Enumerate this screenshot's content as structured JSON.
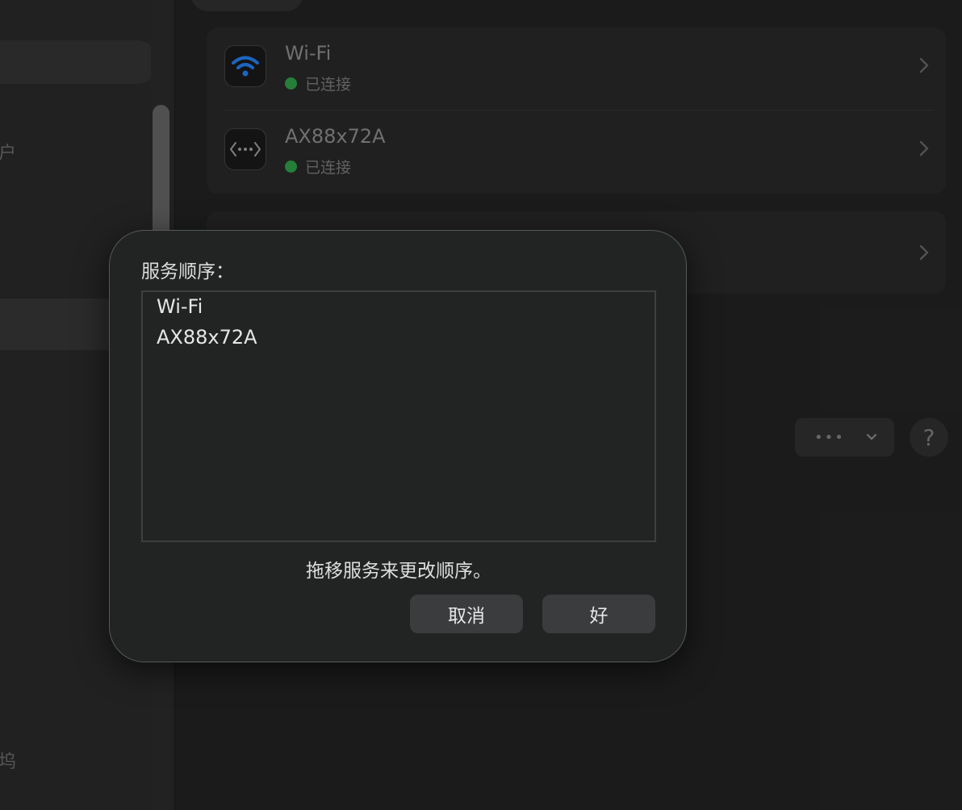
{
  "sidebar": {
    "partial_text_1": "户",
    "partial_text_2": "坞"
  },
  "services": [
    {
      "name": "Wi-Fi",
      "status": "已连接",
      "icon": "wifi-icon"
    },
    {
      "name": "AX88x72A",
      "status": "已连接",
      "icon": "ethernet-icon"
    }
  ],
  "toolbar": {
    "action_label": "•••",
    "help_label": "?"
  },
  "dialog": {
    "title": "服务顺序：",
    "order": [
      "Wi-Fi",
      "AX88x72A"
    ],
    "hint": "拖移服务来更改顺序。",
    "cancel_label": "取消",
    "ok_label": "好"
  },
  "colors": {
    "status_connected": "#2a8a3e",
    "wifi_blue": "#1f6fd1"
  }
}
